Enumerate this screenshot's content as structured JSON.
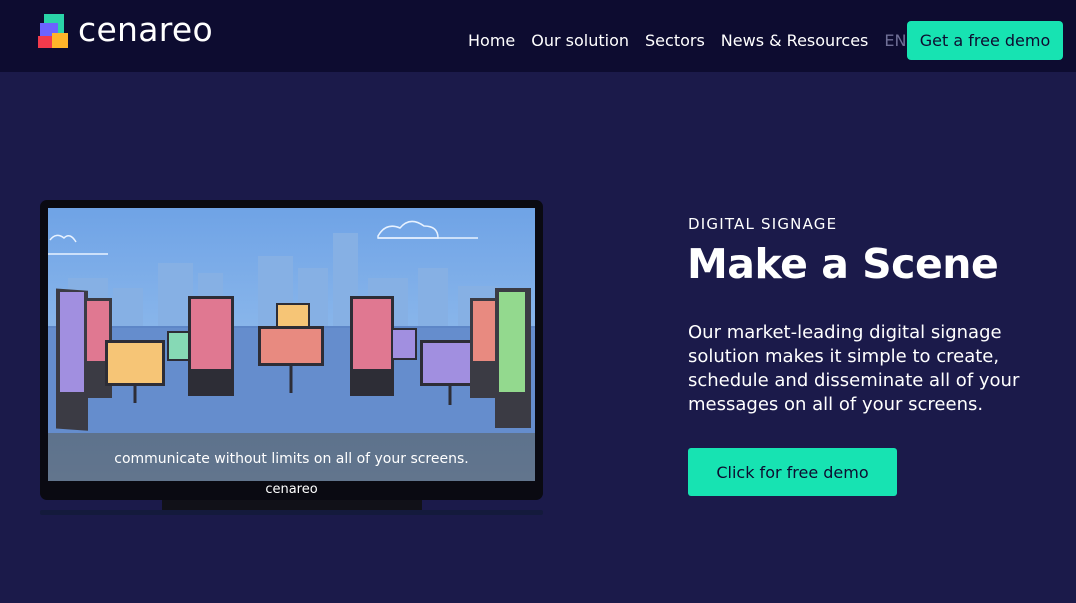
{
  "brand": {
    "name": "cenareo"
  },
  "nav": {
    "items": [
      "Home",
      "Our solution",
      "Sectors",
      "News & Resources"
    ],
    "lang": "EN",
    "cta": "Get a free demo"
  },
  "hero": {
    "eyebrow": "DIGITAL SIGNAGE",
    "title": "Make a Scene",
    "description": "Our market-leading digital signage solution makes it simple to create, schedule and disseminate all of your messages on all of your screens.",
    "cta": "Click for free demo"
  },
  "video": {
    "subtitle": "communicate without limits on all of your screens.",
    "brand": "cenareo"
  },
  "colors": {
    "background": "#1b1a4a",
    "navbar": "#0d0c30",
    "accent": "#17e3b2"
  }
}
